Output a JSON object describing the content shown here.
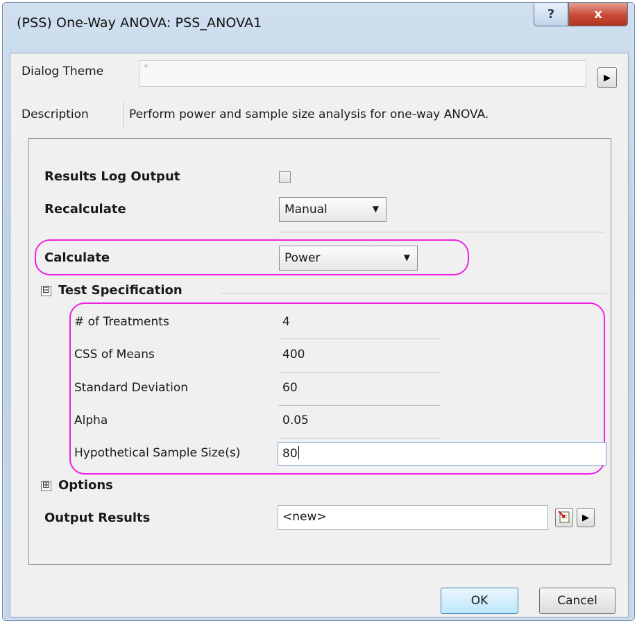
{
  "window": {
    "title": "(PSS) One-Way ANOVA: PSS_ANOVA1",
    "help_glyph": "?",
    "close_glyph": "x"
  },
  "theme": {
    "label": "Dialog Theme",
    "value": "*",
    "arrow": "▶"
  },
  "description": {
    "label": "Description",
    "text": "Perform power and sample size analysis for one-way ANOVA."
  },
  "settings": {
    "results_log_label": "Results Log Output",
    "results_log_checked": false,
    "recalculate_label": "Recalculate",
    "recalculate_value": "Manual",
    "calculate_label": "Calculate",
    "calculate_value": "Power"
  },
  "test_spec": {
    "toggle": "⊟",
    "title": "Test Specification",
    "fields": [
      {
        "label": "# of Treatments",
        "value": "4"
      },
      {
        "label": "CSS of Means",
        "value": "400"
      },
      {
        "label": "Standard Deviation",
        "value": "60"
      },
      {
        "label": "Alpha",
        "value": "0.05"
      },
      {
        "label": "Hypothetical Sample Size(s)",
        "value": "80"
      }
    ]
  },
  "options": {
    "toggle": "⊞",
    "title": "Options"
  },
  "output": {
    "label": "Output Results",
    "value": "<new>",
    "arrow": "▶"
  },
  "buttons": {
    "ok": "OK",
    "cancel": "Cancel"
  },
  "colors": {
    "highlight": "#f020e0"
  }
}
